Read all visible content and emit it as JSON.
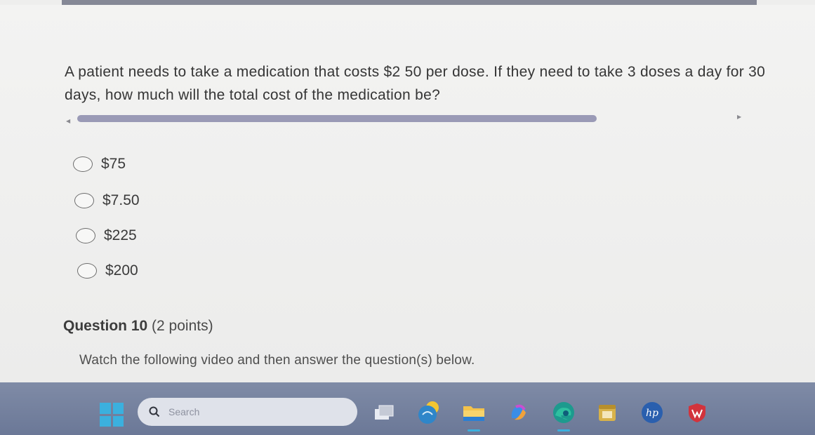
{
  "question": {
    "text": "A patient needs to take a medication that costs $2 50 per dose. If they need to take 3 doses a day for 30 days, how much will the total cost of the medication be?"
  },
  "options": [
    {
      "label": "$75",
      "selected": false
    },
    {
      "label": "$7.50",
      "selected": false
    },
    {
      "label": "$225",
      "selected": false
    },
    {
      "label": "$200",
      "selected": false
    }
  ],
  "next_question": {
    "title": "Question 10",
    "points": "(2 points)",
    "instructions": "Watch the following video and then answer the question(s) below."
  },
  "taskbar": {
    "search_placeholder": "Search",
    "icons": [
      "windows-start-icon",
      "task-view-icon",
      "weather-widget-icon",
      "file-explorer-icon",
      "copilot-icon",
      "edge-browser-icon",
      "calendar-app-icon",
      "hp-app-icon",
      "mcafee-icon"
    ]
  },
  "colors": {
    "page_bg": "#eeeeed",
    "taskbar_bg": "#727f9c",
    "scrollbar": "#9a9ab6",
    "accent": "#3bb0de"
  }
}
